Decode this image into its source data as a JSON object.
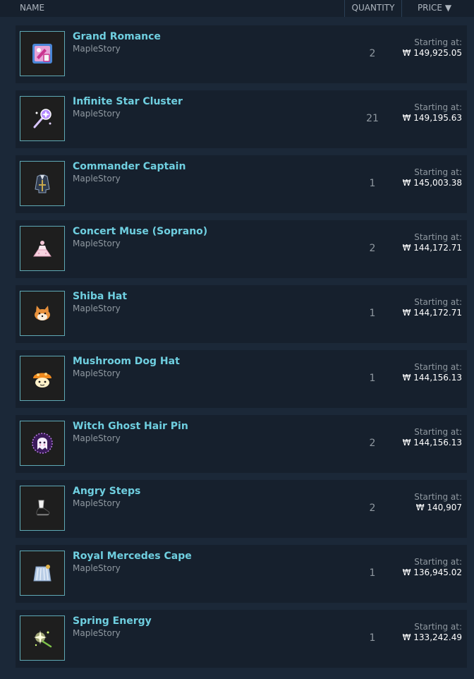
{
  "header": {
    "name": "NAME",
    "quantity": "QUANTITY",
    "price": "PRICE ▼"
  },
  "items": [
    {
      "name": "Grand Romance",
      "game": "MapleStory",
      "quantity": "2",
      "starting_label": "Starting at:",
      "price": "₩ 149,925.05",
      "icon": "potion-icon"
    },
    {
      "name": "Infinite Star Cluster",
      "game": "MapleStory",
      "quantity": "21",
      "starting_label": "Starting at:",
      "price": "₩ 149,195.63",
      "icon": "star-wand-icon"
    },
    {
      "name": "Commander Captain",
      "game": "MapleStory",
      "quantity": "1",
      "starting_label": "Starting at:",
      "price": "₩ 145,003.38",
      "icon": "coat-icon"
    },
    {
      "name": "Concert Muse (Soprano)",
      "game": "MapleStory",
      "quantity": "2",
      "starting_label": "Starting at:",
      "price": "₩ 144,172.71",
      "icon": "dress-icon"
    },
    {
      "name": "Shiba Hat",
      "game": "MapleStory",
      "quantity": "1",
      "starting_label": "Starting at:",
      "price": "₩ 144,172.71",
      "icon": "shiba-icon"
    },
    {
      "name": "Mushroom Dog Hat",
      "game": "MapleStory",
      "quantity": "1",
      "starting_label": "Starting at:",
      "price": "₩ 144,156.13",
      "icon": "mushroom-dog-icon"
    },
    {
      "name": "Witch Ghost Hair Pin",
      "game": "MapleStory",
      "quantity": "2",
      "starting_label": "Starting at:",
      "price": "₩ 144,156.13",
      "icon": "ghost-icon"
    },
    {
      "name": "Angry Steps",
      "game": "MapleStory",
      "quantity": "2",
      "starting_label": "Starting at:",
      "price": "₩ 140,907",
      "icon": "shoe-icon"
    },
    {
      "name": "Royal Mercedes Cape",
      "game": "MapleStory",
      "quantity": "1",
      "starting_label": "Starting at:",
      "price": "₩ 136,945.02",
      "icon": "cape-icon"
    },
    {
      "name": "Spring Energy",
      "game": "MapleStory",
      "quantity": "1",
      "starting_label": "Starting at:",
      "price": "₩ 133,242.49",
      "icon": "sparkle-icon"
    }
  ]
}
